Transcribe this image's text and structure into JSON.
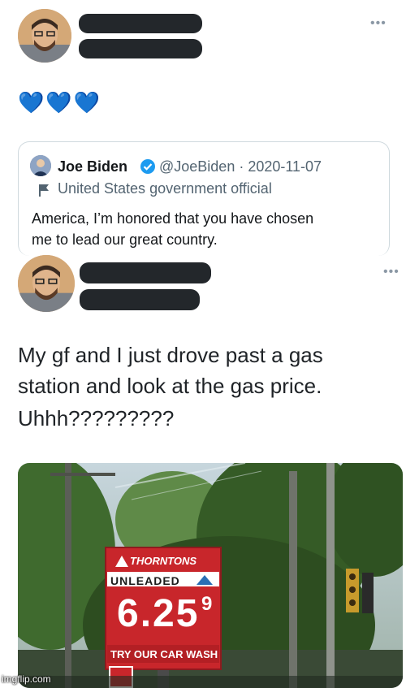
{
  "tweet1": {
    "emoji": "💙💙💙",
    "more_icon": "more-icon",
    "quote": {
      "name": "Joe Biden",
      "handle_date": "@JoeBiden · 2020-11-07",
      "label": "United States government official",
      "text_line1": "America, I’m honored that you have chosen",
      "text_line2": "me to lead our great country."
    }
  },
  "tweet2": {
    "text_line1": "My gf and I just drove past a gas",
    "text_line2": "station and look at the gas price.",
    "text_line3": "Uhhh?????????",
    "photo": {
      "brand": "THORNTONS",
      "grade": "UNLEADED",
      "price_main": "6.25",
      "price_tenth": "9",
      "car_wash": "TRY OUR CAR WASH"
    }
  },
  "watermark": "imgflip.com",
  "colors": {
    "verified": "#1d9bf0",
    "sign_red": "#c8262b"
  }
}
